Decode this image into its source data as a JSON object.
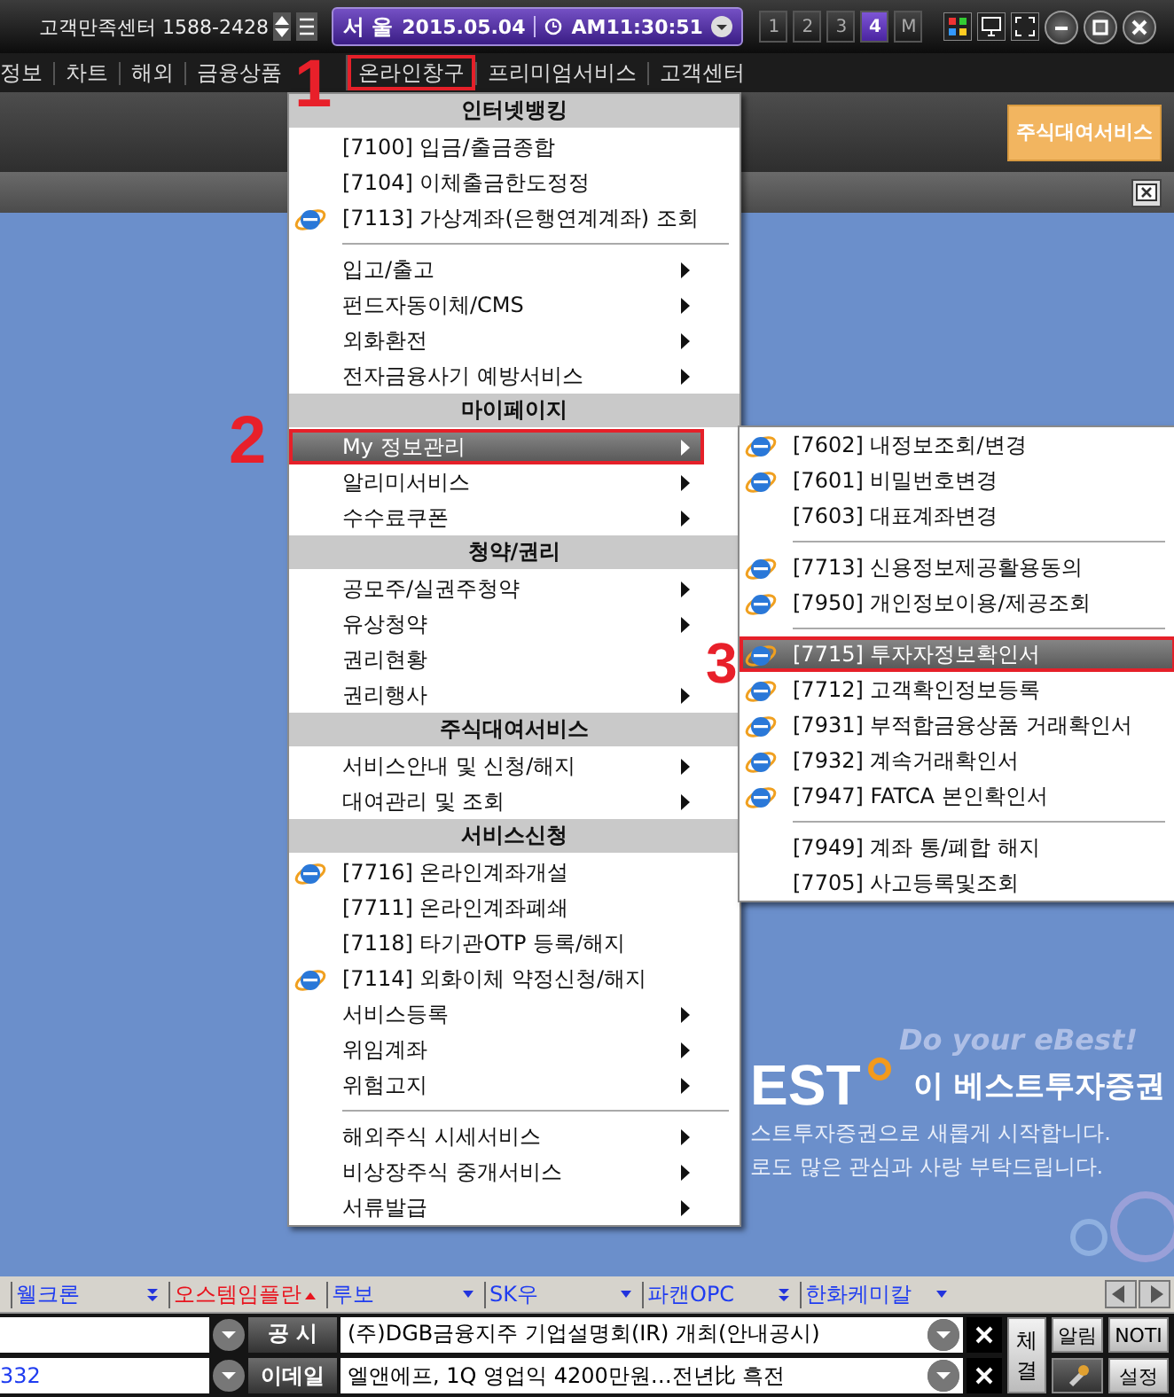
{
  "top_bar": {
    "support": "고객만족센터 1588-2428",
    "city": "서 울",
    "date": "2015.05.04",
    "time": "AM11:30:51",
    "screens": [
      {
        "label": "1",
        "selected": false
      },
      {
        "label": "2",
        "selected": false
      },
      {
        "label": "3",
        "selected": false
      },
      {
        "label": "4",
        "selected": true
      },
      {
        "label": "M",
        "selected": false
      }
    ]
  },
  "menu_bar": [
    {
      "label": "정보"
    },
    {
      "label": "차트"
    },
    {
      "label": "해외"
    },
    {
      "label": "금융상품"
    },
    {
      "label": "온라인창구",
      "callout": "1"
    },
    {
      "label": "프리미엄서비스"
    },
    {
      "label": "고객센터"
    }
  ],
  "toolbar_button": "주식대여서비스",
  "menu": [
    {
      "kind": "header",
      "label": "인터넷뱅킹"
    },
    {
      "kind": "item",
      "label": "[7100] 입금/출금종합",
      "icon": false,
      "submenu": false,
      "selected": false
    },
    {
      "kind": "item",
      "label": "[7104] 이체출금한도정정",
      "icon": false,
      "submenu": false,
      "selected": false
    },
    {
      "kind": "item",
      "label": "[7113] 가상계좌(은행연계계좌) 조회",
      "icon": true,
      "submenu": false,
      "selected": false
    },
    {
      "kind": "separator"
    },
    {
      "kind": "item",
      "label": "입고/출고",
      "icon": false,
      "submenu": true,
      "selected": false
    },
    {
      "kind": "item",
      "label": "펀드자동이체/CMS",
      "icon": false,
      "submenu": true,
      "selected": false
    },
    {
      "kind": "item",
      "label": "외화환전",
      "icon": false,
      "submenu": true,
      "selected": false
    },
    {
      "kind": "item",
      "label": "전자금융사기 예방서비스",
      "icon": false,
      "submenu": true,
      "selected": false
    },
    {
      "kind": "header",
      "label": "마이페이지"
    },
    {
      "kind": "item",
      "label": "My 정보관리",
      "icon": false,
      "submenu": true,
      "selected": true,
      "callout": "2"
    },
    {
      "kind": "item",
      "label": "알리미서비스",
      "icon": false,
      "submenu": true,
      "selected": false
    },
    {
      "kind": "item",
      "label": "수수료쿠폰",
      "icon": false,
      "submenu": true,
      "selected": false
    },
    {
      "kind": "header",
      "label": "청약/권리"
    },
    {
      "kind": "item",
      "label": "공모주/실권주청약",
      "icon": false,
      "submenu": true,
      "selected": false
    },
    {
      "kind": "item",
      "label": "유상청약",
      "icon": false,
      "submenu": true,
      "selected": false
    },
    {
      "kind": "item",
      "label": "권리현황",
      "icon": false,
      "submenu": false,
      "selected": false
    },
    {
      "kind": "item",
      "label": "권리행사",
      "icon": false,
      "submenu": true,
      "selected": false
    },
    {
      "kind": "header",
      "label": "주식대여서비스"
    },
    {
      "kind": "item",
      "label": "서비스안내 및 신청/해지",
      "icon": false,
      "submenu": true,
      "selected": false
    },
    {
      "kind": "item",
      "label": "대여관리 및 조회",
      "icon": false,
      "submenu": true,
      "selected": false
    },
    {
      "kind": "header",
      "label": "서비스신청"
    },
    {
      "kind": "item",
      "label": "[7716] 온라인계좌개설",
      "icon": true,
      "submenu": false,
      "selected": false
    },
    {
      "kind": "item",
      "label": "[7711] 온라인계좌폐쇄",
      "icon": false,
      "submenu": false,
      "selected": false
    },
    {
      "kind": "item",
      "label": "[7118] 타기관OTP 등록/해지",
      "icon": false,
      "submenu": false,
      "selected": false
    },
    {
      "kind": "item",
      "label": "[7114] 외화이체 약정신청/해지",
      "icon": true,
      "submenu": false,
      "selected": false
    },
    {
      "kind": "item",
      "label": "서비스등록",
      "icon": false,
      "submenu": true,
      "selected": false
    },
    {
      "kind": "item",
      "label": "위임계좌",
      "icon": false,
      "submenu": true,
      "selected": false
    },
    {
      "kind": "item",
      "label": "위험고지",
      "icon": false,
      "submenu": true,
      "selected": false
    },
    {
      "kind": "separator"
    },
    {
      "kind": "item",
      "label": "해외주식 시세서비스",
      "icon": false,
      "submenu": true,
      "selected": false
    },
    {
      "kind": "item",
      "label": "비상장주식 중개서비스",
      "icon": false,
      "submenu": true,
      "selected": false
    },
    {
      "kind": "item",
      "label": "서류발급",
      "icon": false,
      "submenu": true,
      "selected": false
    }
  ],
  "submenu": [
    {
      "kind": "item",
      "label": "[7602] 내정보조회/변경",
      "icon": true,
      "selected": false
    },
    {
      "kind": "item",
      "label": "[7601] 비밀번호변경",
      "icon": true,
      "selected": false
    },
    {
      "kind": "item",
      "label": "[7603] 대표계좌변경",
      "icon": false,
      "selected": false
    },
    {
      "kind": "separator"
    },
    {
      "kind": "item",
      "label": "[7713] 신용정보제공활용동의",
      "icon": true,
      "selected": false
    },
    {
      "kind": "item",
      "label": "[7950] 개인정보이용/제공조회",
      "icon": true,
      "selected": false
    },
    {
      "kind": "separator"
    },
    {
      "kind": "item",
      "label": "[7715] 투자자정보확인서",
      "icon": true,
      "selected": true,
      "callout": "3"
    },
    {
      "kind": "item",
      "label": "[7712] 고객확인정보등록",
      "icon": true,
      "selected": false
    },
    {
      "kind": "item",
      "label": "[7931] 부적합금융상품 거래확인서",
      "icon": true,
      "selected": false
    },
    {
      "kind": "item",
      "label": "[7932] 계속거래확인서",
      "icon": true,
      "selected": false
    },
    {
      "kind": "item",
      "label": "[7947] FATCA 본인확인서",
      "icon": true,
      "selected": false
    },
    {
      "kind": "separator"
    },
    {
      "kind": "item",
      "label": "[7949] 계좌 통/폐합 해지",
      "icon": false,
      "selected": false
    },
    {
      "kind": "item",
      "label": "[7705] 사고등록및조회",
      "icon": false,
      "selected": false
    }
  ],
  "banner": {
    "slogan": "Do your eBest!",
    "brand": "EST",
    "name": "이 베스트투자증권",
    "lines": [
      "스트투자증권으로 새롭게 시작합니다.",
      "로도 많은 관심과 사랑 부탁드립니다."
    ]
  },
  "ticker": [
    {
      "name": "웰크론",
      "color": "#1f3cf0",
      "kind": "doubledown"
    },
    {
      "name": "오스템임플란",
      "color": "#e8141e",
      "kind": "up"
    },
    {
      "name": "루보",
      "color": "#1f3cf0",
      "kind": "down"
    },
    {
      "name": "SK우",
      "color": "#1f3cf0",
      "kind": "down"
    },
    {
      "name": "파캔OPC",
      "color": "#1f3cf0",
      "kind": "doubledown"
    },
    {
      "name": "한화케미칼",
      "color": "#1f3cf0",
      "kind": "down"
    }
  ],
  "news_rows": [
    {
      "source": "공 시",
      "headline": "(주)DGB금융지주 기업설명회(IR) 개최(안내공시)"
    },
    {
      "code": "332",
      "source": "이데일",
      "headline": "엘앤에프, 1Q 영업익 4200만원…전년比 흑전"
    }
  ],
  "side_buttons": {
    "trade": "체결",
    "alert": "알림",
    "notice": "NOTI",
    "settings": "설정"
  }
}
